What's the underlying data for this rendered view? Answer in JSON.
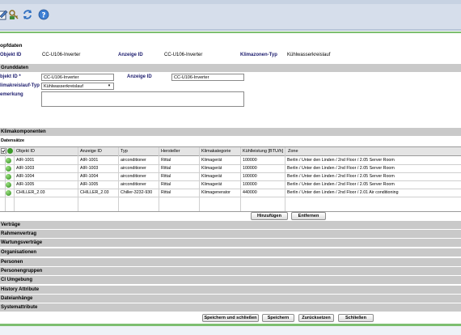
{
  "header": {
    "title": "opfdaten",
    "objekt_id_label": "Objekt ID",
    "objekt_id_value": "CC-U106-Inverter",
    "anzeige_id_label": "Anzeige ID",
    "anzeige_id_value": "CC-U106-Inverter",
    "klimazonen_label": "Klimazonen-Typ",
    "klimazonen_value": "Kühlwasserkreislauf"
  },
  "grunddaten": {
    "section_label": "Grunddaten",
    "objekt_id_label": "bjekt ID *",
    "objekt_id_value": "CC-U106-Inverter",
    "anzeige_id_label": "Anzeige ID",
    "anzeige_id_value": "CC-U106-Inverter",
    "kreislauf_label": "limakreislauf-Typ *",
    "kreislauf_value": "Kühlwasserkreislauf",
    "bemerkung_label": "emerkung"
  },
  "klima": {
    "section_label": "Klimakomponenten",
    "sub_label": "Datensätze",
    "columns": [
      "Objekt ID",
      "Anzeige ID",
      "Typ",
      "Hersteller",
      "Klimakategorie",
      "Kühlleistung [BTU/h]",
      "Zone"
    ],
    "rows": [
      {
        "objekt": "AIR-1001",
        "anzeige": "AIR-1001",
        "typ": "airconditioner",
        "hersteller": "Rittal",
        "kategorie": "Klimagerät",
        "leistung": "100000",
        "zone": "Berlin / Unter den Linden / 2nd Floor / 2.05 Server Room"
      },
      {
        "objekt": "AIR-1003",
        "anzeige": "AIR-1003",
        "typ": "airconditioner",
        "hersteller": "Rittal",
        "kategorie": "Klimagerät",
        "leistung": "100000",
        "zone": "Berlin / Unter den Linden / 2nd Floor / 2.05 Server Room"
      },
      {
        "objekt": "AIR-1004",
        "anzeige": "AIR-1004",
        "typ": "airconditioner",
        "hersteller": "Rittal",
        "kategorie": "Klimagerät",
        "leistung": "100000",
        "zone": "Berlin / Unter den Linden / 2nd Floor / 2.05 Server Room"
      },
      {
        "objekt": "AIR-1005",
        "anzeige": "AIR-1005",
        "typ": "airconditioner",
        "hersteller": "Rittal",
        "kategorie": "Klimagerät",
        "leistung": "100000",
        "zone": "Berlin / Unter den Linden / 2nd Floor / 2.05 Server Room"
      },
      {
        "objekt": "CHILLER_2.03",
        "anzeige": "CHILLER_2.03",
        "typ": "Chiller-3232-930",
        "hersteller": "Rittal",
        "kategorie": "Klimagenerator",
        "leistung": "440000",
        "zone": "Berlin / Unter den Linden / 2nd Floor / 2.01 Air conditioning"
      }
    ],
    "add_button": "Hinzufügen",
    "remove_button": "Entfernen"
  },
  "sections": [
    "Verträge",
    "Rahmenvertrag",
    "Wartungsverträge",
    "Organisationen",
    "Personen",
    "Personengruppen",
    "CI Umgebung",
    "History Attribute",
    "Dateianhänge",
    "Systemattribute"
  ],
  "footer": {
    "save_close": "Speichern und schließen",
    "save": "Speichern",
    "reset": "Zurücksetzen",
    "close": "Schließen"
  },
  "icons": [
    "edit-icon",
    "key-icon",
    "refresh-icon",
    "help-icon"
  ],
  "colors": {
    "section_bg": "#c9c9c9",
    "label_blue": "#1c1c6e",
    "accent_green": "#7dbf70",
    "toolbar_bg": "#d6deeb"
  }
}
